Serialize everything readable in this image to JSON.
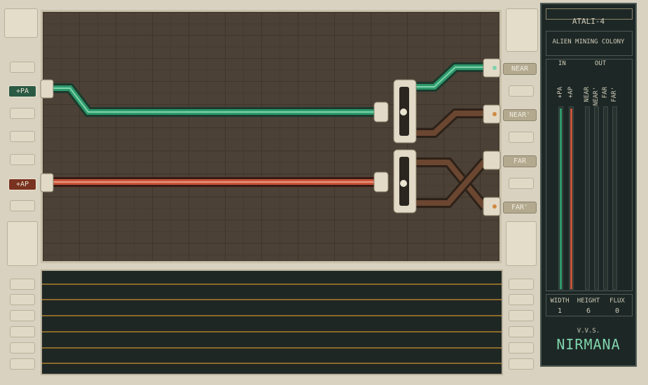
{
  "panel": {
    "level_name": "ATALI-4",
    "level_description": "ALIEN MINING COLONY",
    "io_headers": {
      "in": "IN",
      "out": "OUT"
    },
    "meters": [
      {
        "label": "+PA",
        "color": "#2f9a6c",
        "level": 1.0
      },
      {
        "label": "+AP",
        "color": "#c8543a",
        "level": 1.0
      },
      {
        "label": "NEAR",
        "color": "#2f9a6c",
        "level": 0.0
      },
      {
        "label": "NEAR'",
        "color": "#2f9a6c",
        "level": 0.0
      },
      {
        "label": "FAR",
        "color": "#c8543a",
        "level": 0.0
      },
      {
        "label": "FAR'",
        "color": "#c8543a",
        "level": 0.0
      }
    ],
    "stats": {
      "width_label": "WIDTH",
      "width_value": "1",
      "height_label": "HEIGHT",
      "height_value": "6",
      "flux_label": "FLUX",
      "flux_value": "0"
    },
    "logo_small": "V.V.S.",
    "logo_large": "NIRMANA"
  },
  "inputs": [
    {
      "label": "+PA",
      "color": "#2a5a44"
    },
    {
      "label": "+AP",
      "color": "#7a3220"
    }
  ],
  "outputs": [
    {
      "label": "NEAR"
    },
    {
      "label": "NEAR'"
    },
    {
      "label": "FAR"
    },
    {
      "label": "FAR'"
    }
  ],
  "colors": {
    "green_signal": "#2f9a6c",
    "red_signal": "#c8543a",
    "board_bg": "#4c4136",
    "frame": "#d9d2c0"
  }
}
